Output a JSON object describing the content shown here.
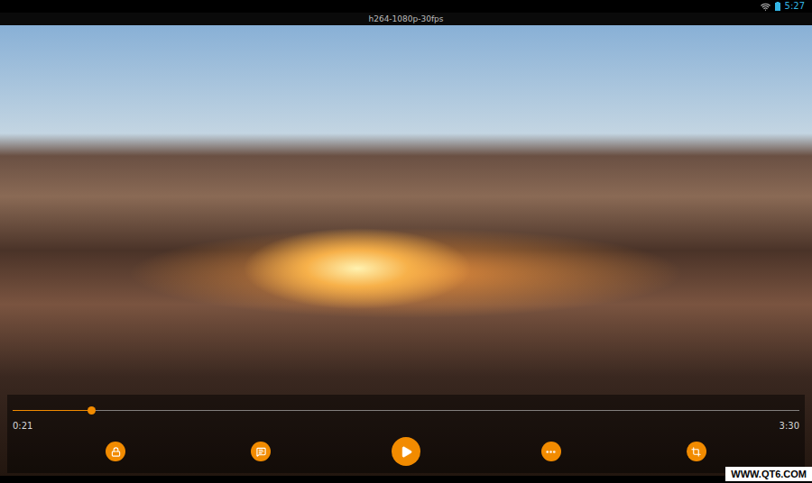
{
  "status_bar": {
    "time": "5:27",
    "wifi": true
  },
  "title": "h264-1080p-30fps",
  "progress": {
    "level": 0.1,
    "elapsed": "0:21",
    "duration": "3:30"
  },
  "playing": false,
  "watermark": "WWW.QT6.COM"
}
